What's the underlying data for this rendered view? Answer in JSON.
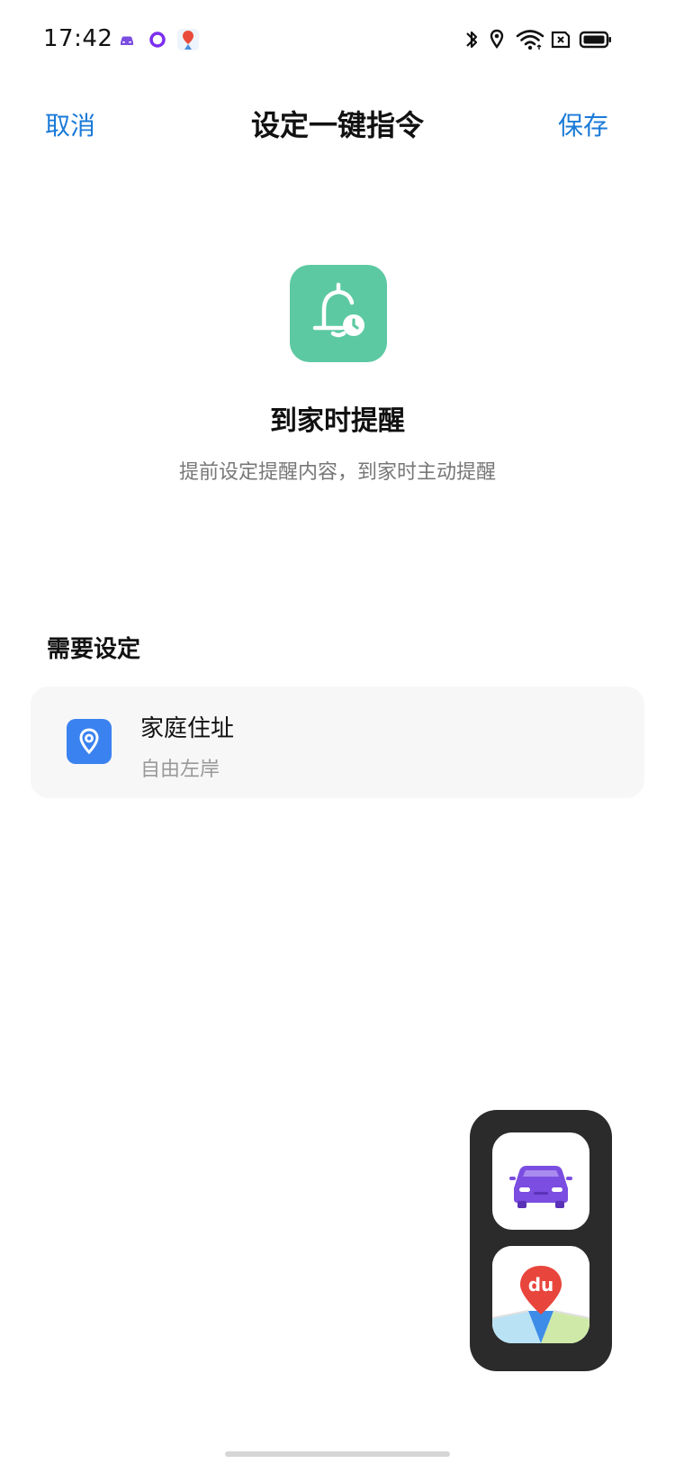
{
  "status_bar": {
    "time": "17:42",
    "notifications": [
      "car-app-icon",
      "circle-app-icon",
      "map-pin-app-icon"
    ],
    "system_icons": [
      "bluetooth-icon",
      "location-icon",
      "wifi-icon",
      "sim-card-icon",
      "battery-icon"
    ]
  },
  "header": {
    "cancel_label": "取消",
    "title": "设定一键指令",
    "save_label": "保存"
  },
  "hero": {
    "icon": "bell-clock-icon",
    "title": "到家时提醒",
    "subtitle": "提前设定提醒内容，到家时主动提醒"
  },
  "section": {
    "title": "需要设定"
  },
  "card": {
    "icon": "location-pin-icon",
    "title": "家庭住址",
    "subtitle": "自由左岸"
  },
  "floating_dock": {
    "apps": [
      "car-app-icon",
      "baidu-map-app-icon"
    ],
    "baidu_text": "du"
  },
  "colors": {
    "accent": "#1a7ad8",
    "hero_icon_bg": "#5cc9a2",
    "card_icon_bg": "#3a82f0",
    "dock_bg": "#2b2b2b",
    "car_purple": "#7b4de0"
  }
}
